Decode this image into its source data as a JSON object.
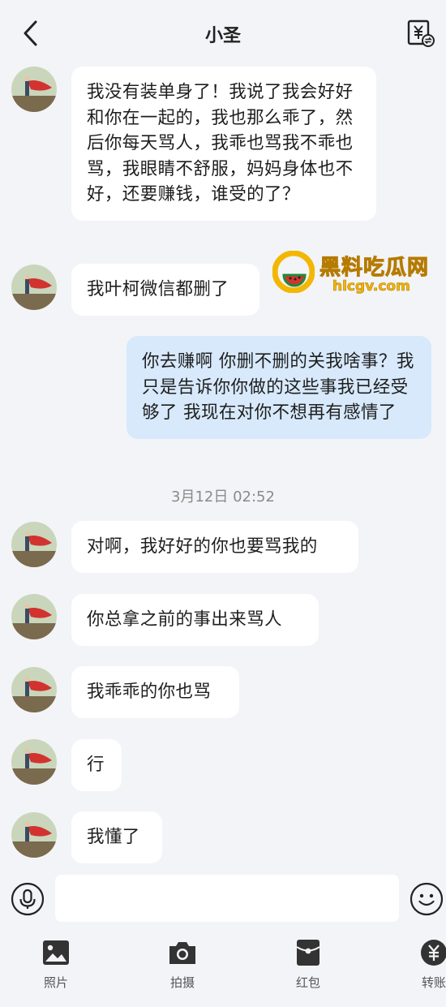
{
  "header": {
    "title": "小圣",
    "back_icon": "chevron-left-icon",
    "transfer_icon": "yuan-transfer-icon"
  },
  "messages": [
    {
      "side": "left",
      "text": "我没有装单身了！我说了我会好好和你在一起的，我也那么乖了，然后你每天骂人，我乖也骂我不乖也骂，我眼睛不舒服，妈妈身体也不好，还要赚钱，谁受的了？"
    },
    {
      "side": "left",
      "text": "我叶柯微信都删了"
    },
    {
      "side": "right",
      "text": "你去赚啊 你删不删的关我啥事？我只是告诉你你做的这些事我已经受够了 我现在对你不想再有感情了"
    },
    {
      "side": "left",
      "text": "对啊，我好好的你也要骂我的"
    },
    {
      "side": "left",
      "text": "你总拿之前的事出来骂人"
    },
    {
      "side": "left",
      "text": "我乖乖的你也骂"
    },
    {
      "side": "left",
      "text": "行"
    },
    {
      "side": "left",
      "text": "我懂了"
    }
  ],
  "timestamp": "3月12日 02:52",
  "watermark": {
    "text": "黑料吃瓜网",
    "url": "hlcgv.com"
  },
  "input": {
    "value": "",
    "voice_icon": "microphone-icon",
    "emoji_icon": "smiley-icon"
  },
  "toolbar": {
    "items": [
      {
        "label": "照片",
        "icon": "photo-icon"
      },
      {
        "label": "拍摄",
        "icon": "camera-icon"
      },
      {
        "label": "红包",
        "icon": "red-packet-icon"
      },
      {
        "label": "转账",
        "icon": "transfer-icon"
      }
    ]
  },
  "colors": {
    "background": "#f3f4f7",
    "incoming_bubble": "#ffffff",
    "outgoing_bubble": "#d7e9fb",
    "watermark": "#f2b705"
  }
}
